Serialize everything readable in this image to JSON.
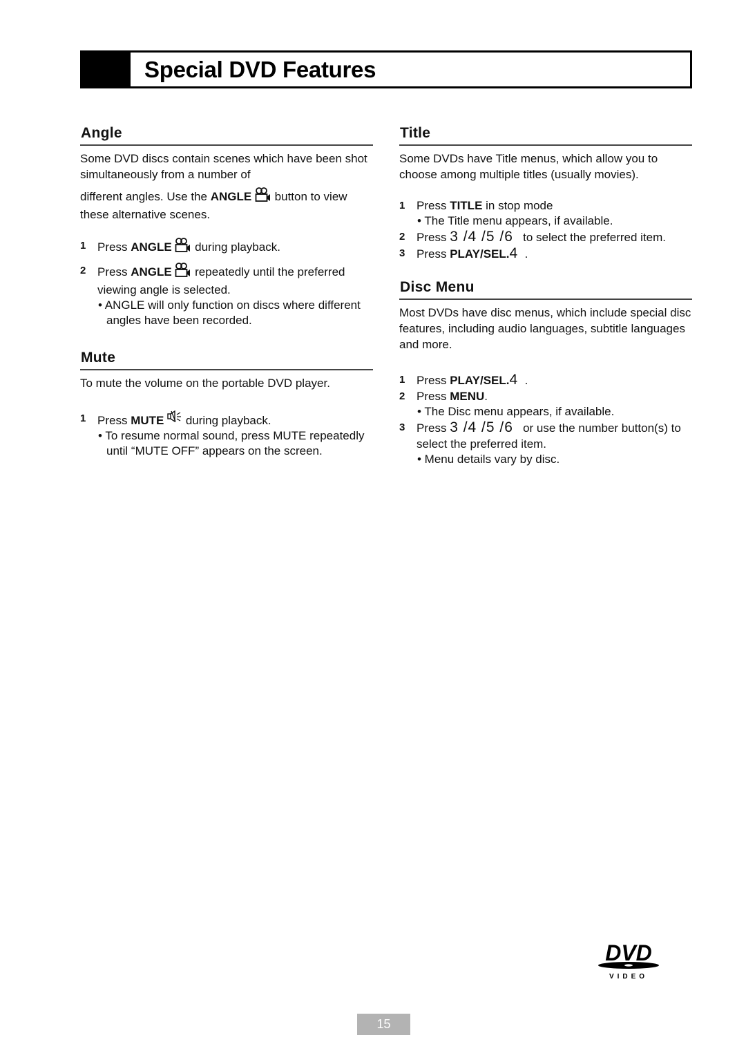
{
  "header": {
    "title": "Special DVD Features"
  },
  "angle": {
    "heading": "Angle",
    "intro_1": "Some DVD discs contain scenes which have been shot simultaneously from a number of",
    "intro_2_pre": "different angles. Use the ",
    "intro_2_bold": "ANGLE",
    "intro_2_post": " button to view these alternative scenes.",
    "steps": [
      {
        "num": "1",
        "pre": "Press ",
        "bold": "ANGLE",
        "post": " during playback."
      },
      {
        "num": "2",
        "pre": "Press ",
        "bold": "ANGLE",
        "post": " repeatedly until the preferred viewing angle is selected."
      }
    ],
    "note": "• ANGLE will only function on discs where different angles have been recorded."
  },
  "mute": {
    "heading": "Mute",
    "intro": "To mute the volume on the portable DVD player.",
    "steps": [
      {
        "num": "1",
        "pre": "Press ",
        "bold": "MUTE",
        "post": " during playback."
      }
    ],
    "note": "• To resume normal sound, press MUTE repeatedly until “MUTE OFF” appears on the screen."
  },
  "title": {
    "heading": "Title",
    "intro": "Some DVDs have Title menus, which allow you to choose among multiple titles (usually movies).",
    "steps": [
      {
        "num": "1",
        "pre": "Press ",
        "bold": "TITLE",
        "post": " in stop mode"
      },
      {
        "num": "2",
        "pre": "Press ",
        "arrows": "3 /4 /5 /6",
        "post": "   to select the preferred item."
      },
      {
        "num": "3",
        "pre": "Press ",
        "bold": "PLAY/SEL.",
        "arrows": "4",
        "post": "  ."
      }
    ],
    "note": "• The Title menu appears, if available."
  },
  "disc_menu": {
    "heading": "Disc Menu",
    "intro": "Most DVDs have disc menus, which include special disc features, including audio languages, subtitle languages and more.",
    "steps": [
      {
        "num": "1",
        "pre": "Press ",
        "bold": "PLAY/SEL.",
        "arrows": "4",
        "post": "  ."
      },
      {
        "num": "2",
        "pre": "Press ",
        "bold": "MENU",
        "post": "."
      },
      {
        "num": "3",
        "pre": "Press ",
        "arrows": "3 /4 /5 /6",
        "post": "   or use the number button(s) to select the preferred item."
      }
    ],
    "note_1": "• The Disc menu appears, if available.",
    "note_2": "• Menu details vary by disc."
  },
  "logo": {
    "text": "DVD",
    "subtext": "VIDEO"
  },
  "footer": {
    "page_number": "15"
  }
}
